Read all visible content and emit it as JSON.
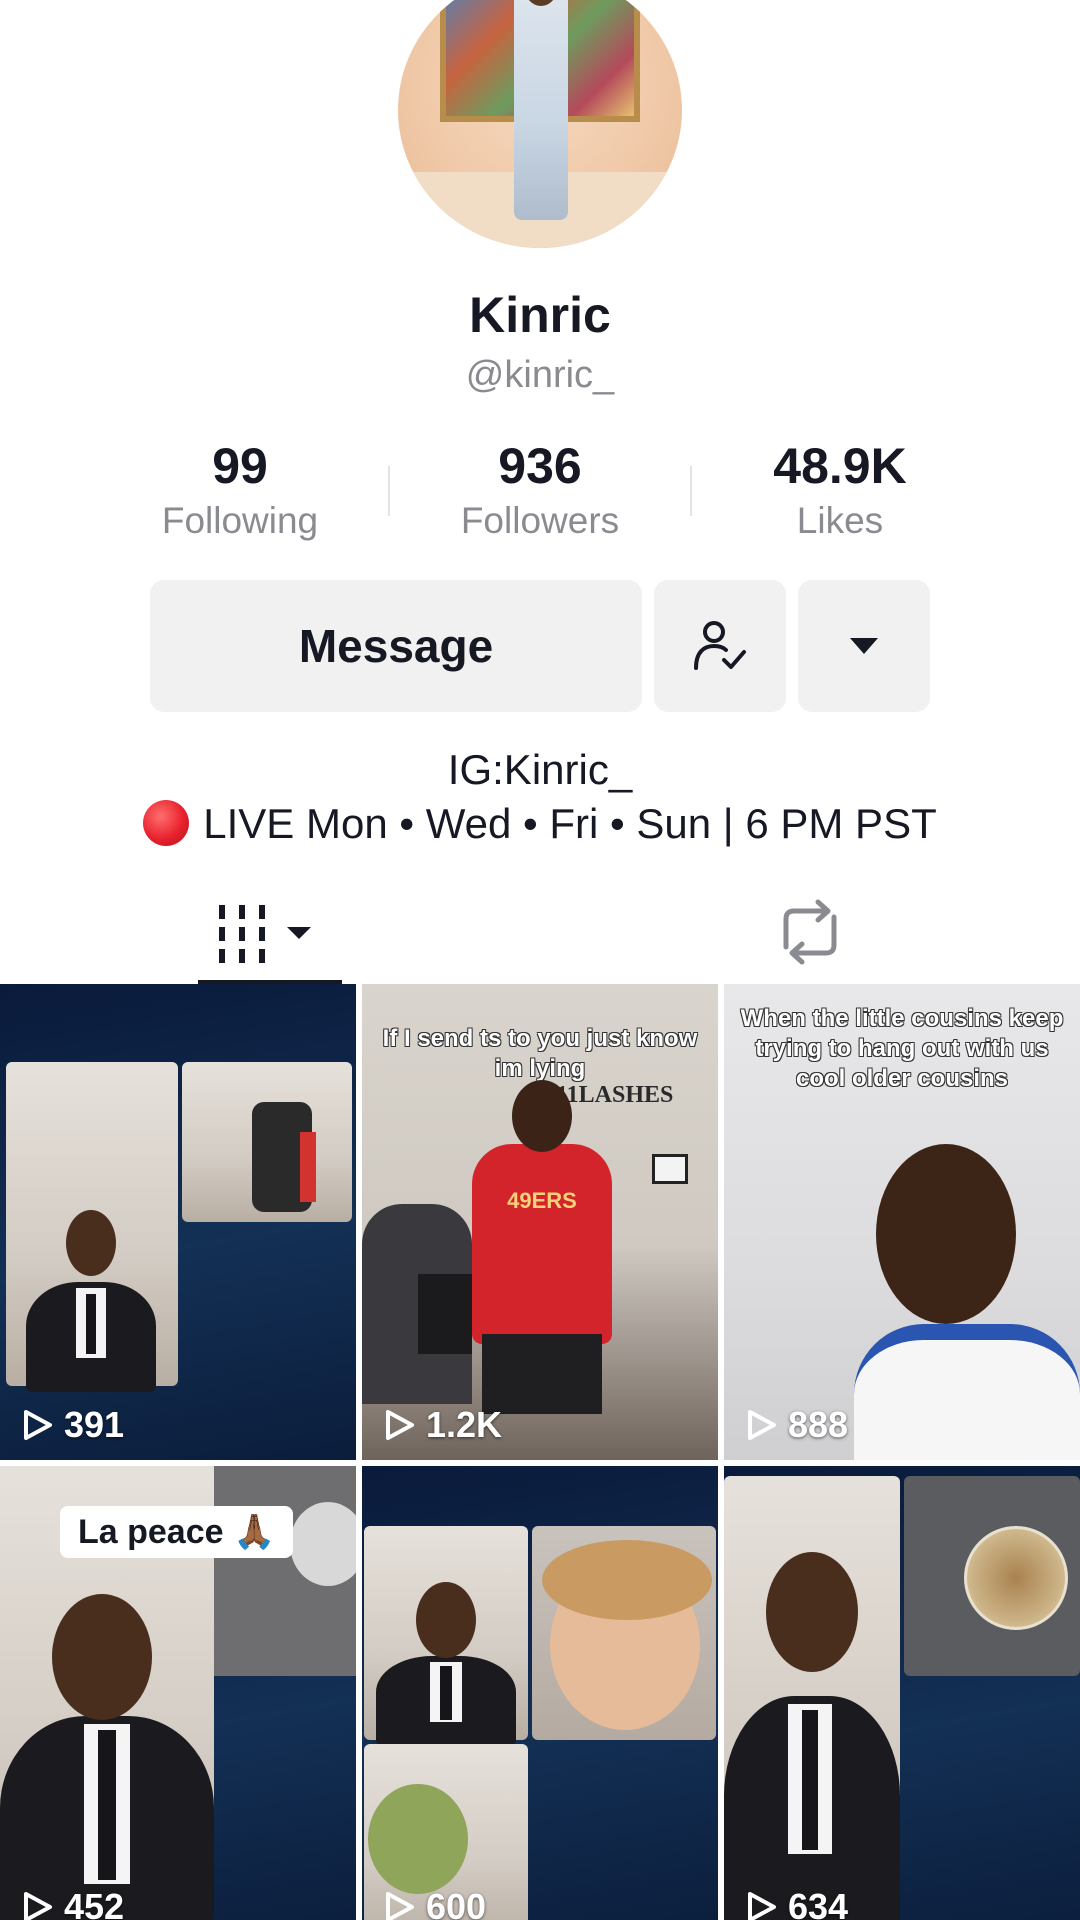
{
  "profile": {
    "name": "Kinric",
    "handle": "@kinric_"
  },
  "stats": {
    "following": {
      "value": "99",
      "label": "Following"
    },
    "followers": {
      "value": "936",
      "label": "Followers"
    },
    "likes": {
      "value": "48.9K",
      "label": "Likes"
    }
  },
  "actions": {
    "message_label": "Message",
    "following_icon": "user-check-icon",
    "more_icon": "caret-down-icon"
  },
  "bio": {
    "line1": "IG:Kinric_",
    "line2": "LIVE Mon • Wed • Fri • Sun | 6 PM PST"
  },
  "tabs": {
    "videos_icon": "grid-bars-icon",
    "reposts_icon": "repost-icon"
  },
  "videos": [
    {
      "views": "391",
      "caption": ""
    },
    {
      "views": "1.2K",
      "caption": "If I send ts to you just know im lying",
      "sign": "211LASHES",
      "shirt": "49ERS"
    },
    {
      "views": "888",
      "caption": "When the little cousins keep trying to hang out with us cool older cousins"
    },
    {
      "views": "452",
      "caption": "La peace 🙏🏾"
    },
    {
      "views": "600",
      "caption": ""
    },
    {
      "views": "634",
      "caption": ""
    }
  ],
  "colors": {
    "text_primary": "#161823",
    "text_secondary": "#8a8b91",
    "button_bg": "#f1f1f2",
    "live_red": "#e8222d"
  }
}
